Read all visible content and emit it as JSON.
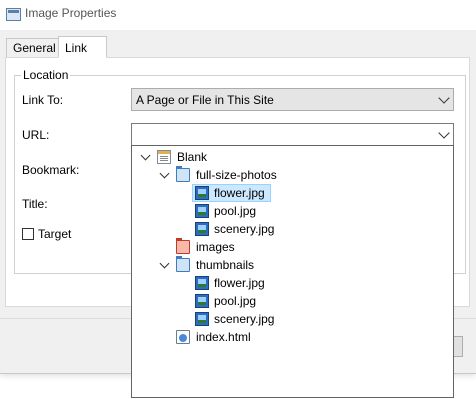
{
  "window": {
    "title": "Image Properties",
    "icon": "image-properties-icon"
  },
  "tabs": [
    {
      "label": "General",
      "active": false
    },
    {
      "label": "Link",
      "active": true
    }
  ],
  "location": {
    "group_title": "Location",
    "link_to_label": "Link To:",
    "link_to_value": "A Page or File in This Site",
    "url_label": "URL:",
    "url_value": "",
    "bookmark_label": "Bookmark:",
    "title_label": "Title:",
    "target_label": "Target",
    "target_checked": false
  },
  "tree": {
    "items": [
      {
        "label": "Blank",
        "icon": "site-icon",
        "expanded": true,
        "level": 0,
        "selected": false
      },
      {
        "label": "full-size-photos",
        "icon": "folder-icon",
        "expanded": true,
        "level": 1,
        "selected": false
      },
      {
        "label": "flower.jpg",
        "icon": "image-file-icon",
        "level": 2,
        "selected": true
      },
      {
        "label": "pool.jpg",
        "icon": "image-file-icon",
        "level": 2,
        "selected": false
      },
      {
        "label": "scenery.jpg",
        "icon": "image-file-icon",
        "level": 2,
        "selected": false
      },
      {
        "label": "images",
        "icon": "images-folder-icon",
        "level": 1,
        "selected": false
      },
      {
        "label": "thumbnails",
        "icon": "folder-icon",
        "expanded": true,
        "level": 1,
        "selected": false
      },
      {
        "label": "flower.jpg",
        "icon": "image-file-icon",
        "level": 2,
        "selected": false
      },
      {
        "label": "pool.jpg",
        "icon": "image-file-icon",
        "level": 2,
        "selected": false
      },
      {
        "label": "scenery.jpg",
        "icon": "image-file-icon",
        "level": 2,
        "selected": false
      },
      {
        "label": "index.html",
        "icon": "html-file-icon",
        "level": 1,
        "selected": false
      }
    ]
  },
  "colors": {
    "selection_bg": "#cce8ff",
    "selection_border": "#99d1ff",
    "folder": "#3f7dbd",
    "images_folder": "#c0392b"
  }
}
